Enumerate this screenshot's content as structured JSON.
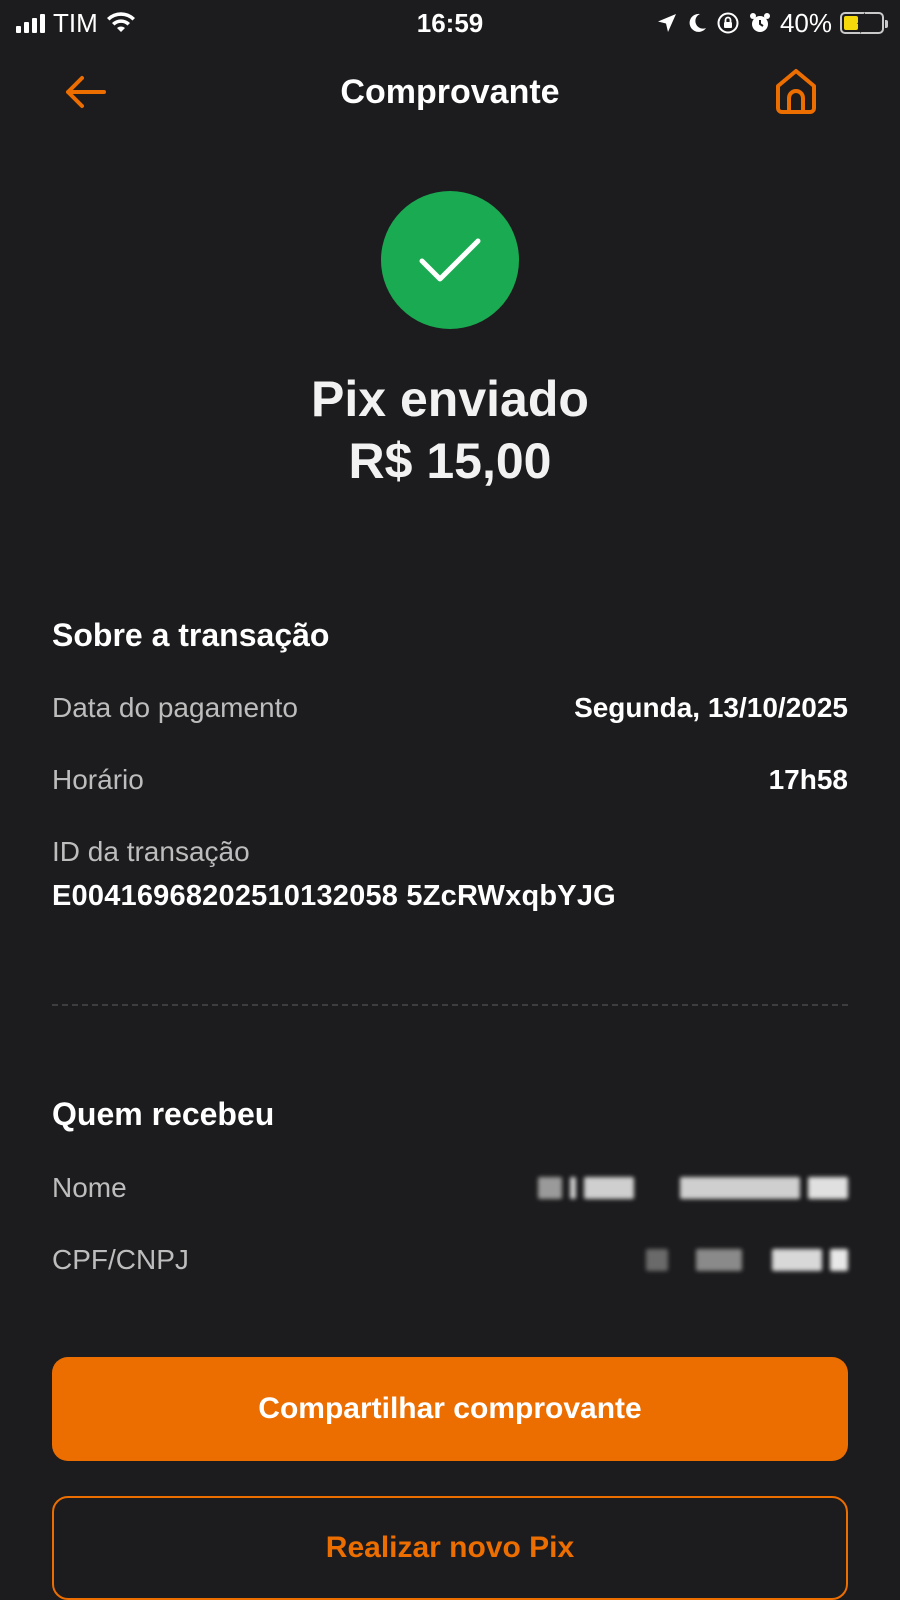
{
  "status_bar": {
    "carrier": "TIM",
    "time": "16:59",
    "battery": "40%"
  },
  "nav": {
    "title": "Comprovante",
    "back_icon": "arrow-left-icon",
    "home_icon": "home-icon"
  },
  "success": {
    "icon": "check-icon",
    "title": "Pix enviado",
    "amount": "R$ 15,00"
  },
  "transaction": {
    "title": "Sobre a transação",
    "payment_date_label": "Data do pagamento",
    "payment_date_value": "Segunda, 13/10/2025",
    "time_label": "Horário",
    "time_value": "17h58",
    "id_label": "ID da transação",
    "id_value": "E00416968202510132058 5ZcRWxqbYJG"
  },
  "recipient": {
    "title": "Quem recebeu",
    "name_label": "Nome",
    "document_label": "CPF/CNPJ"
  },
  "actions": {
    "share_label": "Compartilhar comprovante",
    "new_pix_label": "Realizar novo Pix"
  },
  "colors": {
    "background": "#1c1c1e",
    "accent": "#ec6d00",
    "success": "#1aaa52"
  }
}
